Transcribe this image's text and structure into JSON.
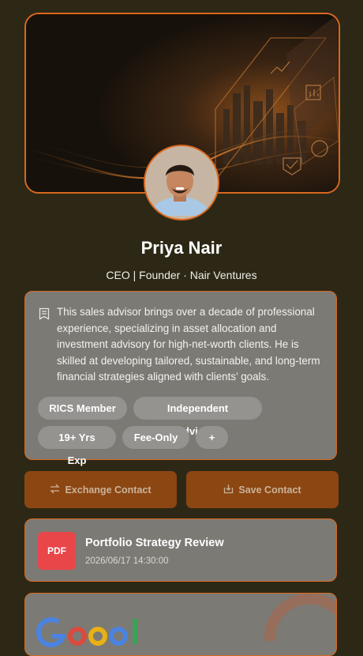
{
  "profile": {
    "name": "Priya Nair",
    "role": "CEO  |  Founder · Nair Ventures"
  },
  "bio": {
    "text": "This sales advisor brings over a decade of professional experience, specializing in asset allocation and investment advisory for high-net-worth clients. He is skilled at developing tailored, sustainable, and long-term financial strategies aligned with clients’ goals."
  },
  "tags": [
    "RICS Member",
    "Independent Advisory",
    "19+ Yrs Exp",
    "Fee-Only",
    "+"
  ],
  "actions": {
    "exchange_label": "Exchange Contact",
    "save_label": "Save Contact"
  },
  "document": {
    "badge": "PDF",
    "title": "Portfolio Strategy Review",
    "date": "2026/06/17 14:30:00"
  },
  "theme": {
    "background": "#2d2816",
    "accent": "#d9691f",
    "card": "#7c7a75",
    "button": "#8c4612",
    "pdf_badge": "#e9464a"
  },
  "icons": {
    "bio": "document-lines-icon",
    "exchange": "swap-arrows-icon",
    "save": "download-box-icon",
    "bottom_logo": "google-logo-icon"
  }
}
